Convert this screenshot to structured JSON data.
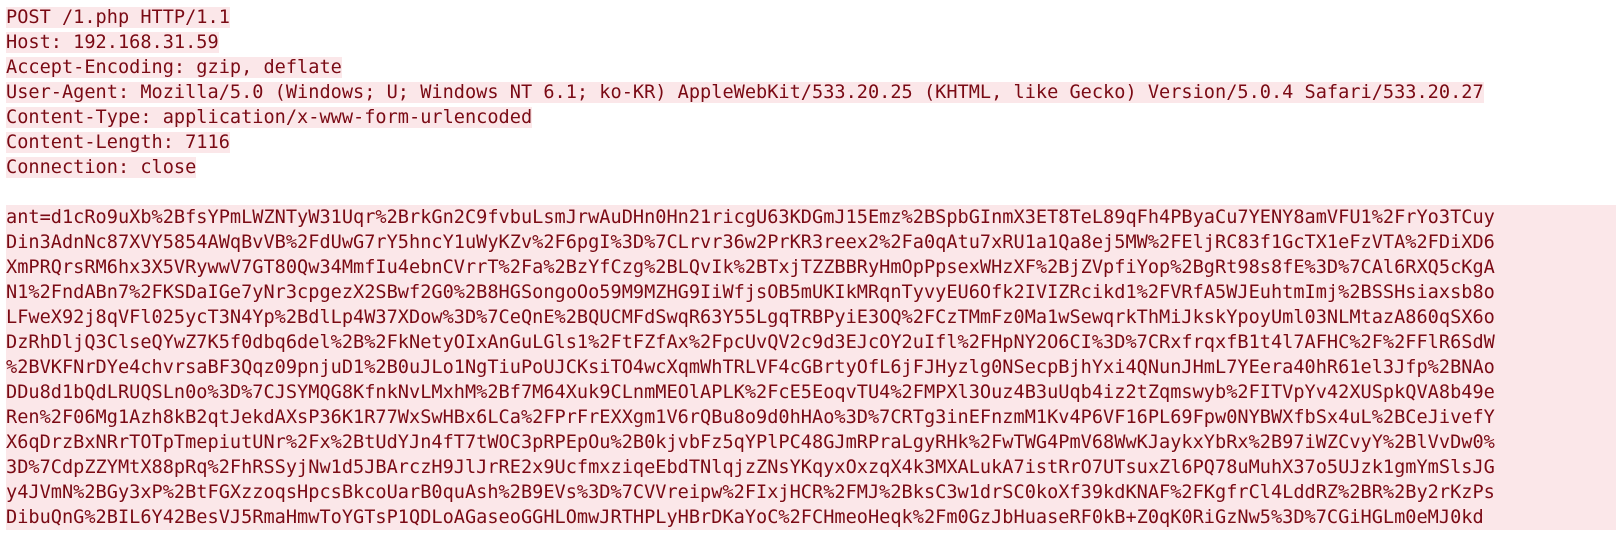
{
  "request": {
    "header_lines": [
      "POST /1.php HTTP/1.1",
      "Host: 192.168.31.59",
      "Accept-Encoding: gzip, deflate",
      "User-Agent: Mozilla/5.0 (Windows; U; Windows NT 6.1; ko-KR) AppleWebKit/533.20.25 (KHTML, like Gecko) Version/5.0.4 Safari/533.20.27",
      "Content-Type: application/x-www-form-urlencoded",
      "Content-Length: 7116",
      "Connection: close"
    ],
    "body_lines": [
      "ant=d1cRo9uXb%2BfsYPmLWZNTyW31Uqr%2BrkGn2C9fvbuLsmJrwAuDHn0Hn21ricgU63KDGmJ15Emz%2BSpbGInmX3ET8TeL89qFh4PByaCu7YENY8amVFU1%2FrYo3TCuy",
      "Din3AdnNc87XVY5854AWqBvVB%2FdUwG7rY5hncY1uWyKZv%2F6pgI%3D%7CLrvr36w2PrKR3reex2%2Fa0qAtu7xRU1a1Qa8ej5MW%2FEljRC83f1GcTX1eFzVTA%2FDiXD6",
      "XmPRQrsRM6hx3X5VRywwV7GT80Qw34MmfIu4ebnCVrrT%2Fa%2BzYfCzg%2BLQvIk%2BTxjTZZBBRyHmOpPpsexWHzXF%2BjZVpfiYop%2BgRt98s8fE%3D%7CAl6RXQ5cKgA",
      "N1%2FndABn7%2FKSDaIGe7yNr3cpgezX2SBwf2G0%2B8HGSongoOo59M9MZHG9IiWfjsOB5mUKIkMRqnTyvyEU6Ofk2IVIZRcikd1%2FVRfA5WJEuhtmImj%2BSSHsiaxsb8o",
      "LFweX92j8qVFl025ycT3N4Yp%2BdlLp4W37XDow%3D%7CeQnE%2BQUCMFdSwqR63Y55LgqTRBPyiE3OQ%2FCzTMmFz0Ma1wSewqrkThMiJkskYpoyUml03NLMtazA860qSX6o",
      "DzRhDljQ3ClseQYwZ7K5f0dbq6del%2B%2FkNetyOIxAnGuLGls1%2FtFZfAx%2FpcUvQV2c9d3EJcOY2uIfl%2FHpNY2O6CI%3D%7CRxfrqxfB1t4l7AFHC%2F%2FFlR6SdW",
      "%2BVKFNrDYe4chvrsaBF3Qqz09pnjuD1%2B0uJLo1NgTiuPoUJCKsiTO4wcXqmWhTRLVF4cGBrtyOfL6jFJHyzlg0NSecpBjhYxi4QNunJHmL7YEera40hR61el3Jfp%2BNAo",
      "DDu8d1bQdLRUQSLn0o%3D%7CJSYMQG8KfnkNvLMxhM%2Bf7M64Xuk9CLnmMEOlAPLK%2FcE5EoqvTU4%2FMPXl3Ouz4B3uUqb4iz2tZqmswyb%2FITVpYv42XUSpkQVA8b49e",
      "Ren%2F06Mg1Azh8kB2qtJekdAXsP36K1R77WxSwHBx6LCa%2FPrFrEXXgm1V6rQBu8o9d0hHAo%3D%7CRTg3inEFnzmM1Kv4P6VF16PL69Fpw0NYBWXfbSx4uL%2BCeJivefY",
      "X6qDrzBxNRrTOTpTmepiutUNr%2Fx%2BtUdYJn4fT7tWOC3pRPEpOu%2B0kjvbFz5qYPlPC48GJmRPraLgyRHk%2FwTWG4PmV68WwKJaykxYbRx%2B97iWZCvyY%2BlVvDw0%",
      "3D%7CdpZZYMtX88pRq%2FhRSSyjNw1d5JBArczH9JlJrRE2x9UcfmxziqeEbdTNlqjzZNsYKqyxOxzqX4k3MXALukA7istRrO7UTsuxZl6PQ78uMuhX37o5UJzk1gmYmSlsJG",
      "y4JVmN%2BGy3xP%2BtFGXzzoqsHpcsBkcoUarB0quAsh%2B9EVs%3D%7CVVreipw%2FIxjHCR%2FMJ%2BksC3w1drSC0koXf39kdKNAF%2FKgfrCl4LddRZ%2BR%2By2rKzPs",
      "DibuQnG%2BIL6Y42BesVJ5RmaHmwToYGTsP1QDLoAGaseoGGHLOmwJRTHPLyHBrDKaYoC%2FCHmeoHeqk%2Fm0GzJbHuaseRF0kB+Z0qK0RiGzNw5%3D%7CGiHGLm0eMJ0kd"
    ]
  }
}
